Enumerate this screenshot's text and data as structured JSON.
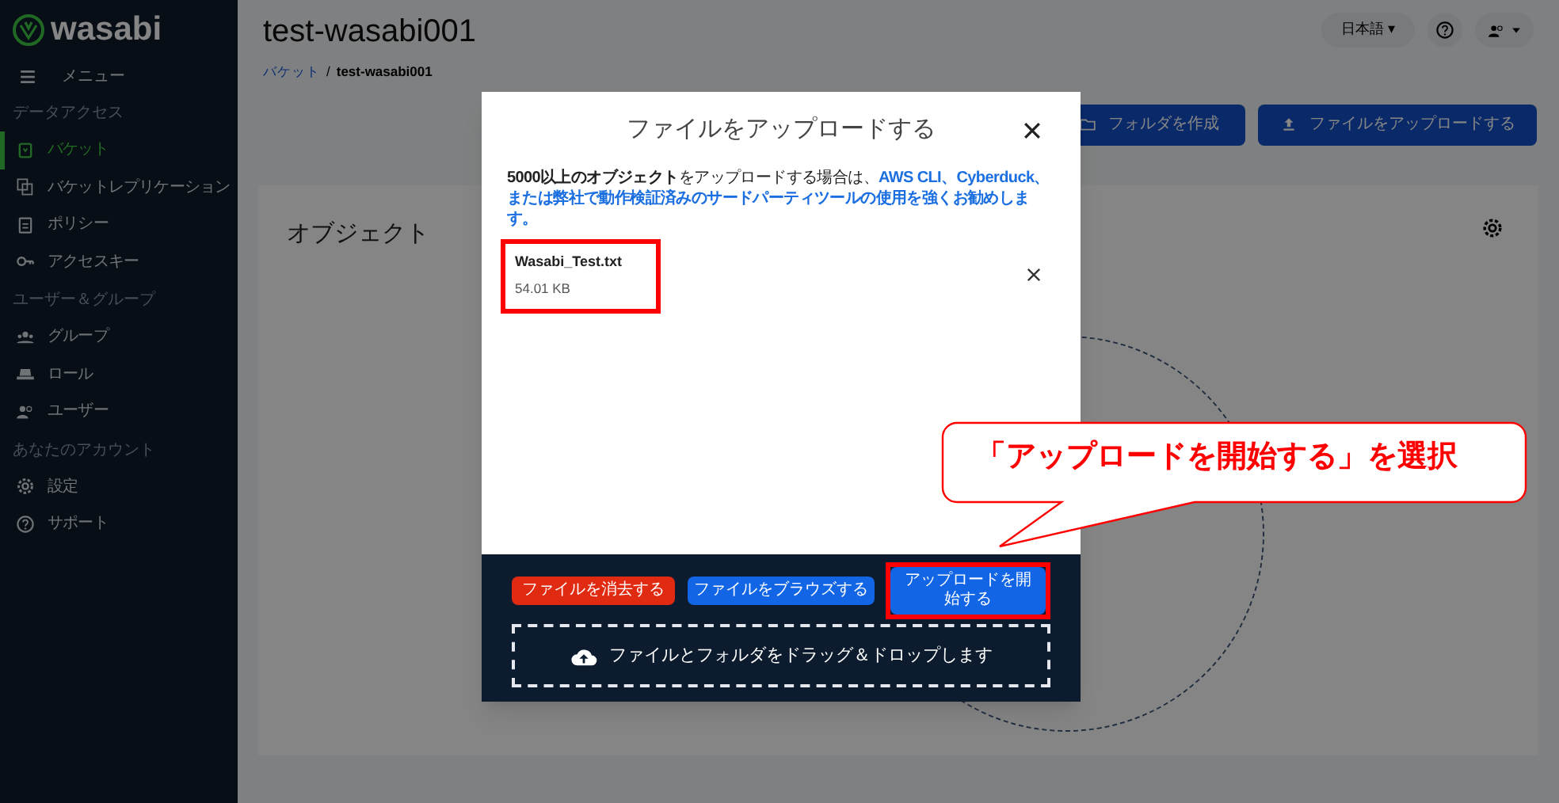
{
  "sidebar": {
    "logo": "wasabi",
    "menu": {
      "label": "メニュー"
    },
    "sections": [
      {
        "heading": "データアクセス",
        "items": [
          {
            "label": "バケット",
            "selected": true
          },
          {
            "label": "バケットレプリケーション",
            "selected": false
          },
          {
            "label": "ポリシー",
            "selected": false
          },
          {
            "label": "アクセスキー",
            "selected": false
          }
        ]
      },
      {
        "heading": "ユーザー＆グループ",
        "items": [
          {
            "label": "グループ",
            "selected": false
          },
          {
            "label": "ロール",
            "selected": false
          },
          {
            "label": "ユーザー",
            "selected": false
          }
        ]
      },
      {
        "heading": "あなたのアカウント",
        "items": [
          {
            "label": "設定",
            "selected": false
          },
          {
            "label": "サポート",
            "selected": false
          }
        ]
      }
    ]
  },
  "header": {
    "title": "test-wasabi001",
    "breadcrumb": [
      "バケット",
      "test-wasabi001"
    ],
    "breadcrumb_separator": "/",
    "language": "日本語",
    "dropdown_caret": "▾"
  },
  "actions": [
    {
      "label": "フォルダを作成"
    },
    {
      "label": "ファイルをアップロードする"
    }
  ],
  "card": {
    "title": "オブジェクト"
  },
  "modal": {
    "title": "ファイルをアップロードする",
    "notice": "**5000以上のオブジェクト**をアップロードする場合は、",
    "notice_link": "AWS CLI、Cyberduck、または弊社で動作検証済みのサードパーティツールの使用を強くお勧めします。",
    "files": [
      {
        "name": "Wasabi_Test.txt",
        "size": "54.01 KB"
      }
    ],
    "buttons": [
      {
        "label": "ファイルを消去する",
        "kind": "danger"
      },
      {
        "label": "ファイルをブラウズする",
        "kind": "primary"
      },
      {
        "label": "アップロードを開始する",
        "kind": "primary"
      }
    ],
    "dropzone": "ファイルとフォルダをドラッグ＆ドロップします"
  },
  "annotation": {
    "callout": "「アップロードを開始する」を選択"
  }
}
